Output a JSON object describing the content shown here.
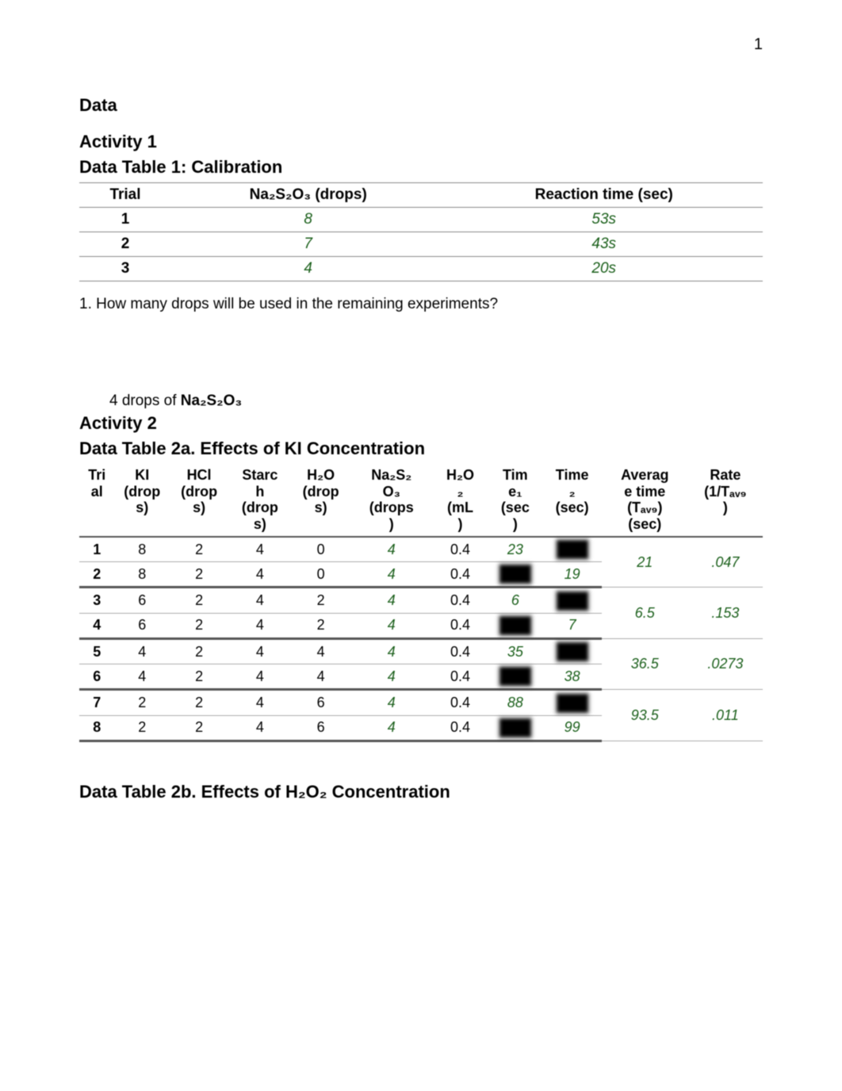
{
  "page_number": "1",
  "headings": {
    "data": "Data",
    "activity1": "Activity 1",
    "table1_title": "Data Table 1: Calibration",
    "activity2": "Activity 2",
    "table2a_title": "Data Table 2a. Effects of KI Concentration",
    "table2b_title": "Data Table 2b. Effects of H₂O₂ Concentration"
  },
  "table1": {
    "headers": {
      "trial": "Trial",
      "drops": "Na₂S₂O₃ (drops)",
      "time": "Reaction time (sec)"
    },
    "rows": [
      {
        "trial": "1",
        "drops": "8",
        "time": "53s"
      },
      {
        "trial": "2",
        "drops": "7",
        "time": "43s"
      },
      {
        "trial": "3",
        "drops": "4",
        "time": "20s"
      }
    ]
  },
  "question1": {
    "text": "1. How many drops will be used in the remaining experiments?",
    "answer_prefix": "4 drops of ",
    "answer_chem": "Na₂S₂O₃"
  },
  "table2a": {
    "headers": {
      "trial": "Trial",
      "ki": "KI (drops)",
      "hcl": "HCl (drops)",
      "starch": "Starch (drops)",
      "h2o": "H₂O (drops)",
      "na2s2o3": "Na₂S₂O₃ (drops)",
      "h2o2": "H₂O₂ (mL)",
      "time1": "Time₁ (sec)",
      "time2": "Time₂ (sec)",
      "avg": "Average time (Tₐᵥ₉) (sec)",
      "rate": "Rate (1/Tₐᵥ₉)"
    },
    "header_lines": {
      "trial": [
        "Tri",
        "al"
      ],
      "ki": [
        "KI",
        "(drop",
        "s)"
      ],
      "hcl": [
        "HCl",
        "(drop",
        "s)"
      ],
      "starch": [
        "Starc",
        "h",
        "(drop",
        "s)"
      ],
      "h2o": [
        "H₂O",
        "(drop",
        "s)"
      ],
      "na2s2o3": [
        "Na₂S₂",
        "O₃",
        "(drops",
        ")"
      ],
      "h2o2": [
        "H₂O",
        "₂",
        "(mL",
        ")"
      ],
      "time1": [
        "Tim",
        "e₁",
        "(sec",
        ")"
      ],
      "time2": [
        "Time",
        "₂",
        "(sec)"
      ],
      "avg": [
        "Averag",
        "e time",
        "(Tₐᵥ₉)",
        "(sec)"
      ],
      "rate": [
        "Rate",
        "(1/Tₐᵥ₉",
        ")"
      ]
    },
    "groups": [
      {
        "rows": [
          {
            "trial": "1",
            "ki": "8",
            "hcl": "2",
            "starch": "4",
            "h2o": "0",
            "na": "4",
            "h2o2": "0.4",
            "time1": "23",
            "time2": ""
          },
          {
            "trial": "2",
            "ki": "8",
            "hcl": "2",
            "starch": "4",
            "h2o": "0",
            "na": "4",
            "h2o2": "0.4",
            "time1": "",
            "time2": "19"
          }
        ],
        "avg": "21",
        "rate": ".047"
      },
      {
        "rows": [
          {
            "trial": "3",
            "ki": "6",
            "hcl": "2",
            "starch": "4",
            "h2o": "2",
            "na": "4",
            "h2o2": "0.4",
            "time1": "6",
            "time2": ""
          },
          {
            "trial": "4",
            "ki": "6",
            "hcl": "2",
            "starch": "4",
            "h2o": "2",
            "na": "4",
            "h2o2": "0.4",
            "time1": "",
            "time2": "7"
          }
        ],
        "avg": "6.5",
        "rate": ".153"
      },
      {
        "rows": [
          {
            "trial": "5",
            "ki": "4",
            "hcl": "2",
            "starch": "4",
            "h2o": "4",
            "na": "4",
            "h2o2": "0.4",
            "time1": "35",
            "time2": ""
          },
          {
            "trial": "6",
            "ki": "4",
            "hcl": "2",
            "starch": "4",
            "h2o": "4",
            "na": "4",
            "h2o2": "0.4",
            "time1": "",
            "time2": "38"
          }
        ],
        "avg": "36.5",
        "rate": ".0273"
      },
      {
        "rows": [
          {
            "trial": "7",
            "ki": "2",
            "hcl": "2",
            "starch": "4",
            "h2o": "6",
            "na": "4",
            "h2o2": "0.4",
            "time1": "88",
            "time2": ""
          },
          {
            "trial": "8",
            "ki": "2",
            "hcl": "2",
            "starch": "4",
            "h2o": "6",
            "na": "4",
            "h2o2": "0.4",
            "time1": "",
            "time2": "99"
          }
        ],
        "avg": "93.5",
        "rate": ".011"
      }
    ]
  }
}
